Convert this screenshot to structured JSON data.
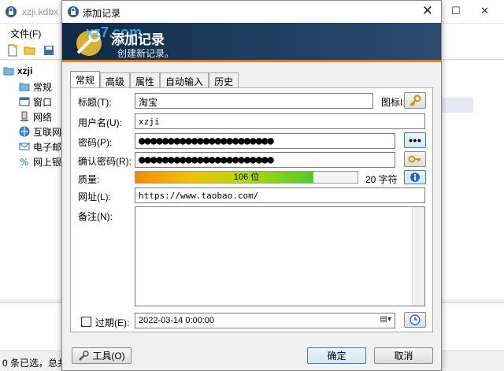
{
  "main_window": {
    "title": "xzji.kdbx",
    "menu": {
      "file": "文件(F)"
    },
    "tree": {
      "root": "xzji",
      "items": [
        "常规",
        "窗口",
        "网络",
        "互联网",
        "电子邮",
        "网上银"
      ]
    },
    "status": "0 条已选，总共"
  },
  "dialog": {
    "title": "添加记录",
    "close_glyph": "✕",
    "banner": {
      "title": "添加记录",
      "subtitle": "创建新记录。",
      "watermark": "xz7.com"
    },
    "tabs": [
      "常规",
      "高级",
      "属性",
      "自动输入",
      "历史"
    ],
    "form": {
      "title_label": "标题(T):",
      "title_value": "淘宝",
      "icon_label": "图标I:",
      "username_label": "用户名(U):",
      "username_value": "xzji",
      "password_label": "密码(P):",
      "password_value": "●●●●●●●●●●●●●●●●●●●●●●●",
      "confirm_label": "确认密码(R):",
      "confirm_value": "●●●●●●●●●●●●●●●●●●●●●●●",
      "quality_label": "质量:",
      "quality_text": "106 位",
      "quality_fraction": 0.8,
      "chars_text": "20 字符",
      "url_label": "网址(L):",
      "url_value": "https://www.taobao.com/",
      "notes_label": "备注(N):",
      "notes_value": "",
      "expiry_label": "过期(E):",
      "expiry_value": "2022-03-14   0:00:00",
      "show_password_glyph": "●●●"
    },
    "buttons": {
      "tools": "工具(O)",
      "ok": "确定",
      "cancel": "取消"
    }
  },
  "colors": {
    "banner_bg": "#1d3c5c",
    "banner_accent": "#e87c1a"
  }
}
